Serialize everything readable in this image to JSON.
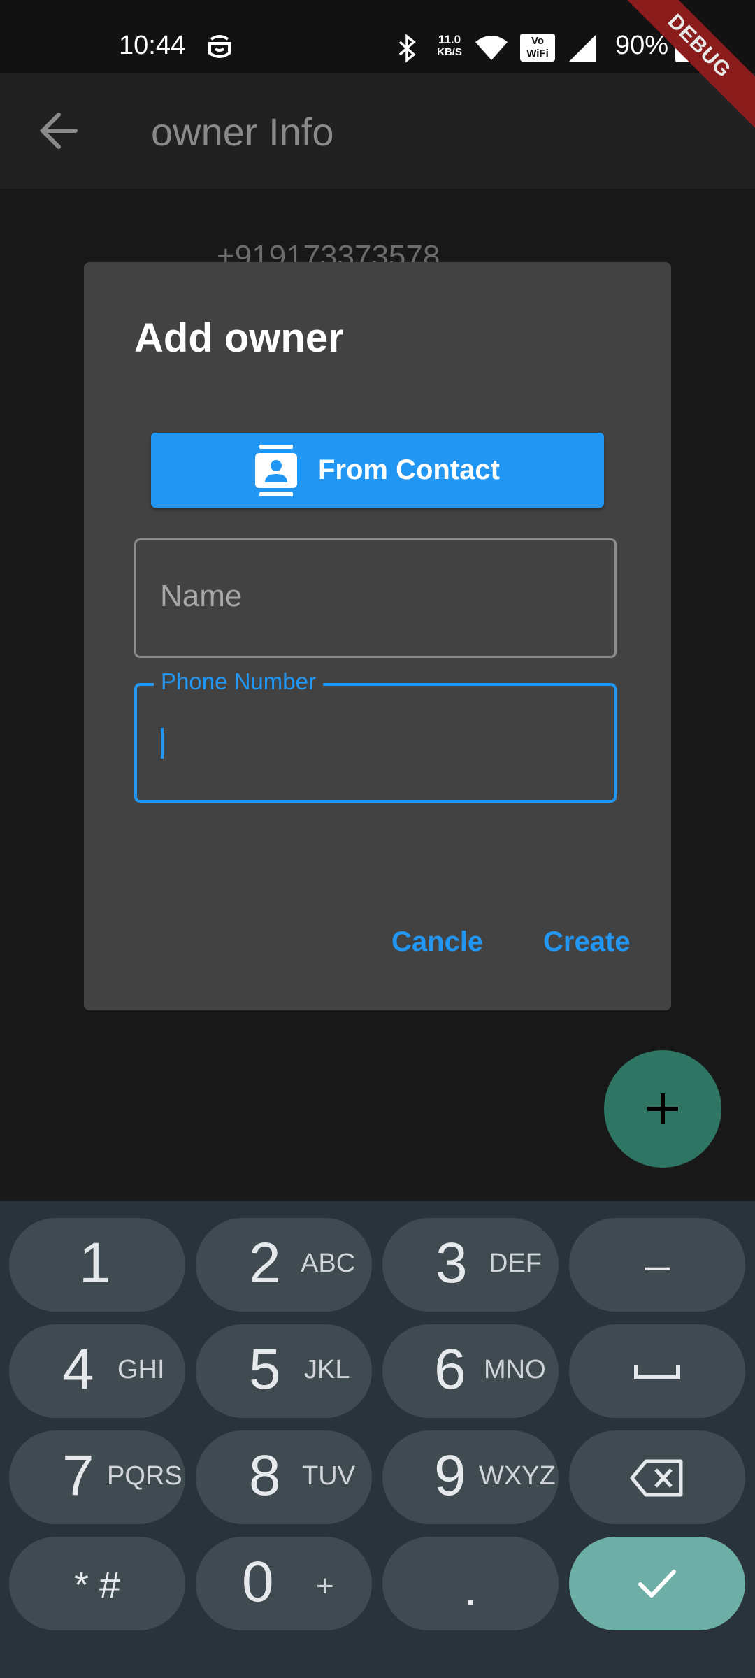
{
  "status_bar": {
    "time": "10:44",
    "net_speed_top": "11.0",
    "net_speed_bottom": "KB/S",
    "vowifi_top": "Vo",
    "vowifi_bottom": "WiFi",
    "battery": "90%",
    "icons": [
      "notification-icon",
      "bluetooth-icon",
      "wifi-icon",
      "vowifi-icon",
      "signal-icon",
      "battery-icon"
    ]
  },
  "debug_banner": "DEBUG",
  "app_bar": {
    "title": "owner Info",
    "back_icon": "arrow-back-icon"
  },
  "background": {
    "phone": "+919173373578"
  },
  "dialog": {
    "title": "Add owner",
    "from_contact_label": "From Contact",
    "name_placeholder": "Name",
    "phone_label": "Phone Number",
    "phone_value": "",
    "cancel_label": "Cancle",
    "create_label": "Create"
  },
  "fab": {
    "icon": "plus-icon"
  },
  "keyboard": {
    "keys": [
      {
        "digit": "1",
        "letters": ""
      },
      {
        "digit": "2",
        "letters": "ABC"
      },
      {
        "digit": "3",
        "letters": "DEF"
      },
      {
        "digit": "–",
        "letters": ""
      },
      {
        "digit": "4",
        "letters": "GHI"
      },
      {
        "digit": "5",
        "letters": "JKL"
      },
      {
        "digit": "6",
        "letters": "MNO"
      },
      {
        "digit": "␣",
        "letters": ""
      },
      {
        "digit": "7",
        "letters": "PQRS"
      },
      {
        "digit": "8",
        "letters": "TUV"
      },
      {
        "digit": "9",
        "letters": "WXYZ"
      },
      {
        "digit": "⌫",
        "letters": ""
      },
      {
        "digit": "* #",
        "letters": ""
      },
      {
        "digit": "0",
        "letters": "+"
      },
      {
        "digit": ".",
        "letters": ""
      },
      {
        "digit": "✓",
        "letters": ""
      }
    ]
  },
  "colors": {
    "accent": "#2196f3",
    "dialog_bg": "#424242",
    "fab": "#2e7564",
    "keyboard_bg": "#29333a",
    "key_bg": "#3f4a51",
    "done_key": "#6daea6"
  }
}
